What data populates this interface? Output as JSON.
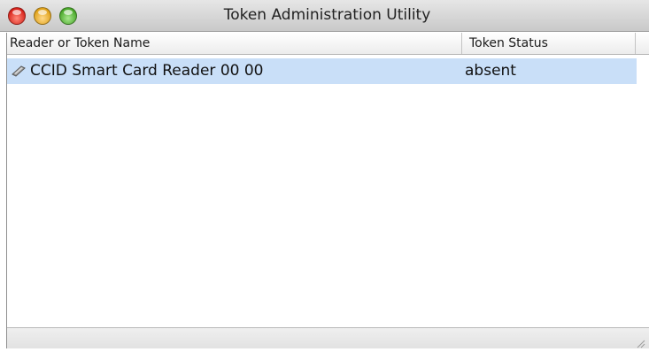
{
  "window": {
    "title": "Token Administration Utility"
  },
  "table": {
    "columns": [
      "Reader or Token Name",
      "Token Status"
    ],
    "rows": [
      {
        "name": "CCID Smart Card Reader 00 00",
        "status": "absent",
        "icon": "smart-card-reader-icon",
        "selected": true
      }
    ]
  },
  "colors": {
    "selection": "#c9dff8",
    "close": "#d8231b",
    "minimize": "#e0a21a",
    "zoom": "#4aa82a"
  }
}
